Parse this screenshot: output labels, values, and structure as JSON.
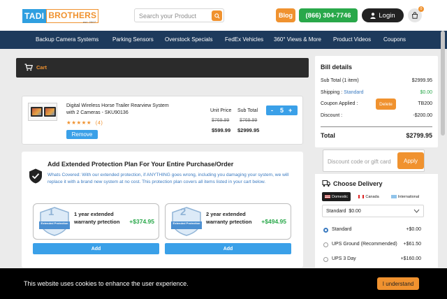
{
  "header": {
    "logo_part1": "TADI",
    "logo_part2": "BROTHERS",
    "logo_est": "est. 2007",
    "search_placeholder": "Search your Product",
    "blog_label": "Blog",
    "phone_label": "(866) 304-7746",
    "login_label": "Login",
    "cart_count": "0"
  },
  "nav": {
    "items": [
      "Backup Camera Systems",
      "Parking Sensors",
      "Overstock Specials",
      "FedEx Vehicles",
      "360° Views & More",
      "Product Videos",
      "Coupons"
    ]
  },
  "cart_bar": {
    "label": "Cart"
  },
  "product": {
    "title": "Digital Wireless Horse Trailer Rearview System with 2 Cameras - SKU90136",
    "stars": "★★★★★",
    "review_count": "(4)",
    "rating": 5,
    "remove_label": "Remove",
    "unit_price_label": "Unit Price",
    "subtotal_label": "Sub Total",
    "unit_price_old": "$769.99",
    "subtotal_old": "$769.99",
    "unit_price": "$599.99",
    "subtotal": "$2999.95",
    "qty_minus": "-",
    "qty": "5",
    "qty_plus": "+"
  },
  "protection": {
    "title": "Add Extended Protection Plan For Your Entire Purchase/Order",
    "description": "Whats Covered: With our extended protection, if ANYTHING goes wrong, including you damaging your system, we will replace it with a brand new system at no cost. This protection plan covers all items listed in your cart below.",
    "plans": [
      {
        "badge_number": "1",
        "badge_text": "Extended Protection",
        "name": "1 year extended warranty prtection",
        "price": "+$374.95",
        "add_label": "Add"
      },
      {
        "badge_number": "2",
        "badge_text": "Extended Protection",
        "name": "2 year extended warranty prtection",
        "price": "+$494.95",
        "add_label": "Add"
      }
    ]
  },
  "bill": {
    "title": "Bill details",
    "subtotal_label": "Sub Total (1 item)",
    "subtotal_value": "$2999.95",
    "shipping_label": "Shipping :",
    "shipping_method": "Standard",
    "shipping_value": "$0.00",
    "coupon_label": "Coupon Applied :",
    "delete_label": "Delete",
    "coupon_code": "TB200",
    "discount_label": "Discount :",
    "discount_value": "-$200.00",
    "total_label": "Total",
    "total_value": "$2799.95"
  },
  "coupon": {
    "placeholder": "Discount code or gift card",
    "apply_label": "Apply"
  },
  "delivery": {
    "title": "Choose Delivery",
    "regions": [
      "Domestic",
      "Canada",
      "International"
    ],
    "selected_option": "Standard",
    "selected_price": "$0.00",
    "options": [
      {
        "label": "Standard",
        "price": "+$0.00"
      },
      {
        "label": "UPS Ground (Recommended)",
        "price": "+$61.50"
      },
      {
        "label": "UPS 3 Day",
        "price": "+$160.00"
      }
    ]
  },
  "cookie": {
    "text": "This website uses cookies to enhance the user experience.",
    "button_label": "I understand"
  },
  "colors": {
    "accent_orange": "#f0922f",
    "nav_blue": "#1d3a5c",
    "button_blue": "#3aa0e8",
    "green": "#29a84a"
  }
}
